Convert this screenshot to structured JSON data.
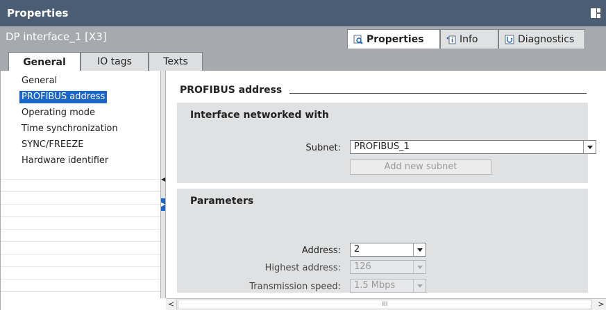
{
  "window": {
    "title": "Properties",
    "object_name": "DP interface_1 [X3]"
  },
  "inspector_tabs": [
    {
      "label": "Properties",
      "icon": "magnifier-icon",
      "active": true
    },
    {
      "label": "Info",
      "icon": "info-icon",
      "active": false
    },
    {
      "label": "Diagnostics",
      "icon": "diagnostics-icon",
      "active": false
    }
  ],
  "sub_tabs": [
    {
      "label": "General",
      "active": true
    },
    {
      "label": "IO tags",
      "active": false
    },
    {
      "label": "Texts",
      "active": false
    }
  ],
  "nav": {
    "items": [
      "General",
      "PROFIBUS address",
      "Operating mode",
      "Time synchronization",
      "SYNC/FREEZE",
      "Hardware identifier"
    ],
    "selected": "PROFIBUS address"
  },
  "section": {
    "title": "PROFIBUS address"
  },
  "interface_group": {
    "title": "Interface networked with",
    "subnet_label": "Subnet:",
    "subnet_value": "PROFIBUS_1",
    "add_subnet_label": "Add new subnet"
  },
  "parameters_group": {
    "title": "Parameters",
    "address_label": "Address:",
    "address_value": "2",
    "highest_label": "Highest address:",
    "highest_value": "126",
    "speed_label": "Transmission speed:",
    "speed_value": "1.5 Mbps"
  },
  "scrollbar": {
    "left_arrow": "<",
    "thumb_grip": "III",
    "right_arrow": ">"
  },
  "colors": {
    "title_bar": "#4a5d72",
    "header_bar": "#a6a9ad",
    "selection": "#1a66cc",
    "group_bg": "#e0e1e2"
  }
}
